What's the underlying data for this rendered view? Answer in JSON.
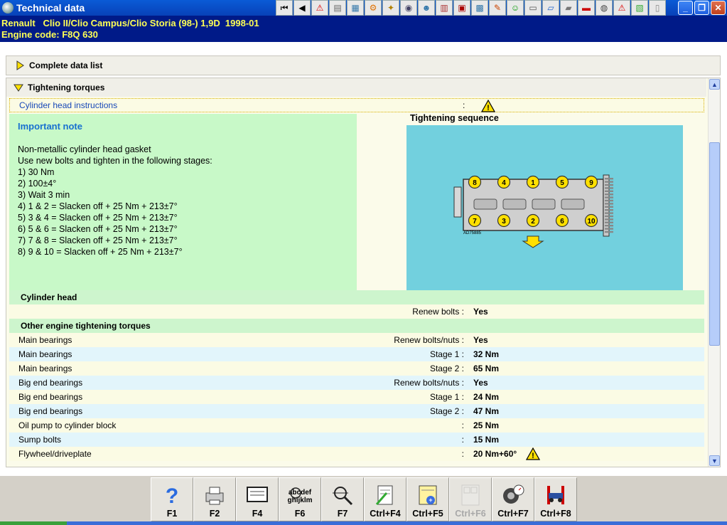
{
  "window": {
    "title": "Technical data"
  },
  "vehicle": {
    "line1": "Renault   Clio II/Clio Campus/Clio Storia (98-) 1,9D  1998-01",
    "line2": "Engine code: F8Q 630"
  },
  "toolbar": {
    "icons": [
      "first-icon",
      "prev-icon",
      "warning-icon",
      "doc-icon",
      "chart-icon",
      "gear-icon",
      "wrench-icon",
      "clock-icon",
      "people-icon",
      "book-icon",
      "lift-icon",
      "car-icon",
      "tool-icon",
      "smiley-icon",
      "tray-icon",
      "car-blue-icon",
      "car-grey-icon",
      "car-red-icon",
      "tyre-icon",
      "warning2-icon",
      "circuit-icon",
      "tablet-icon"
    ]
  },
  "sections": {
    "complete": "Complete data list",
    "torques": "Tightening torques"
  },
  "instructions": {
    "label": "Cylinder head instructions",
    "sep": ":"
  },
  "note": {
    "title": "Important note",
    "lines": [
      "Non-metallic cylinder head gasket",
      "Use new bolts and tighten in the following stages:",
      "1) 30 Nm",
      "2) 100±4°",
      "3) Wait 3 min",
      "4) 1 & 2 = Slacken off + 25 Nm + 213±7°",
      "5) 3 & 4 = Slacken off + 25 Nm + 213±7°",
      "6) 5 & 6 = Slacken off + 25 Nm + 213±7°",
      "7) 7 & 8 = Slacken off + 25 Nm + 213±7°",
      "8) 9 & 10 = Slacken off + 25 Nm + 213±7°"
    ]
  },
  "sequence": {
    "title": "Tightening sequence",
    "top_bolts": [
      "8",
      "4",
      "1",
      "5",
      "9"
    ],
    "bottom_bolts": [
      "7",
      "3",
      "2",
      "6",
      "10"
    ],
    "figure_code": "AD75885"
  },
  "cylinder_head": {
    "heading": "Cylinder head",
    "mid": "Renew bolts :",
    "val": "Yes"
  },
  "other_heading": "Other engine tightening torques",
  "rows": [
    {
      "label": "Main bearings",
      "mid": "Renew bolts/nuts :",
      "val": "Yes"
    },
    {
      "label": "Main bearings",
      "mid": "Stage 1 :",
      "val": "32 Nm"
    },
    {
      "label": "Main bearings",
      "mid": "Stage 2 :",
      "val": "65 Nm"
    },
    {
      "label": "Big end bearings",
      "mid": "Renew bolts/nuts :",
      "val": "Yes"
    },
    {
      "label": "Big end bearings",
      "mid": "Stage 1 :",
      "val": "24 Nm"
    },
    {
      "label": "Big end bearings",
      "mid": "Stage 2 :",
      "val": "47 Nm"
    },
    {
      "label": "Oil pump to cylinder block",
      "mid": ":",
      "val": "25 Nm"
    },
    {
      "label": "Sump bolts",
      "mid": ":",
      "val": "15 Nm"
    },
    {
      "label": "Flywheel/driveplate",
      "mid": ":",
      "val": "20 Nm+60°"
    }
  ],
  "fkeys": [
    {
      "label": "F1",
      "icon": "help-icon",
      "enabled": true
    },
    {
      "label": "F2",
      "icon": "printer-icon",
      "enabled": true
    },
    {
      "label": "F4",
      "icon": "screen-icon",
      "enabled": true
    },
    {
      "label": "F6",
      "icon": "search-text-icon",
      "enabled": true
    },
    {
      "label": "F7",
      "icon": "magnifier-icon",
      "enabled": true
    },
    {
      "label": "Ctrl+F4",
      "icon": "edit-doc-icon",
      "enabled": true
    },
    {
      "label": "Ctrl+F5",
      "icon": "add-note-icon",
      "enabled": true
    },
    {
      "label": "Ctrl+F6",
      "icon": "calculator-icon",
      "enabled": false
    },
    {
      "label": "Ctrl+F7",
      "icon": "gauge-icon",
      "enabled": true
    },
    {
      "label": "Ctrl+F8",
      "icon": "car-lift-icon",
      "enabled": true
    }
  ]
}
